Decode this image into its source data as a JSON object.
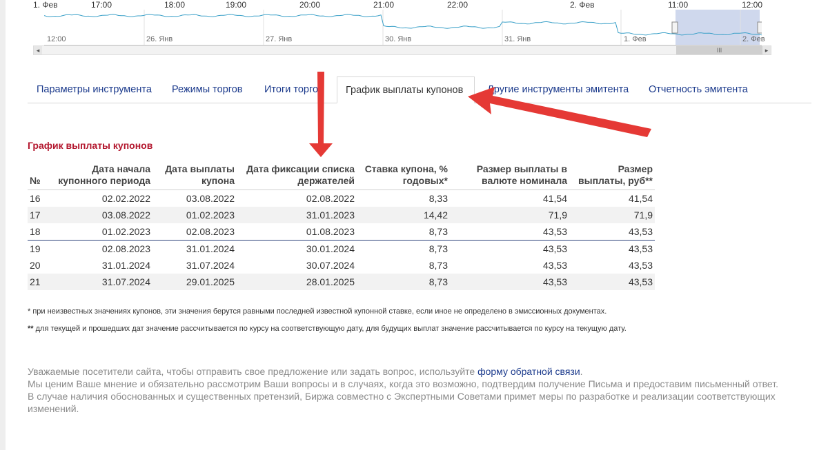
{
  "navigator": {
    "top_ticks": [
      "1. Фев",
      "17:00",
      "18:00",
      "19:00",
      "20:00",
      "21:00",
      "22:00",
      "2. Фев",
      "11:00",
      "12:00"
    ],
    "bottom_ticks": [
      "12:00",
      "26. Янв",
      "27. Янв",
      "30. Янв",
      "31. Янв",
      "1. Фев",
      "2. Фев"
    ],
    "scroll_left": "◂",
    "scroll_right": "▸",
    "thumb_grip": "III",
    "handle_grip": "II",
    "line_color": "#3aa0c8",
    "selection_color": "#c7d1ea"
  },
  "tabs": [
    {
      "label": "Параметры инструмента",
      "active": false
    },
    {
      "label": "Режимы торгов",
      "active": false
    },
    {
      "label": "Итоги торгов",
      "active": false
    },
    {
      "label": "График выплаты купонов",
      "active": true
    },
    {
      "label": "Другие инструменты эмитента",
      "active": false
    },
    {
      "label": "Отчетность эмитента",
      "active": false
    }
  ],
  "section_title": "График выплаты купонов",
  "table": {
    "headers": [
      "№",
      "Дата начала купонного периода",
      "Дата выплаты купона",
      "Дата фиксации списка держателей",
      "Ставка купона, % годовых*",
      "Размер выплаты в валюте номинала",
      "Размер выплаты, руб**"
    ],
    "rows": [
      [
        "16",
        "02.02.2022",
        "03.08.2022",
        "02.08.2022",
        "8,33",
        "41,54",
        "41,54"
      ],
      [
        "17",
        "03.08.2022",
        "01.02.2023",
        "31.01.2023",
        "14,42",
        "71,9",
        "71,9"
      ],
      [
        "18",
        "01.02.2023",
        "02.08.2023",
        "01.08.2023",
        "8,73",
        "43,53",
        "43,53"
      ],
      [
        "19",
        "02.08.2023",
        "31.01.2024",
        "30.01.2024",
        "8,73",
        "43,53",
        "43,53"
      ],
      [
        "20",
        "31.01.2024",
        "31.07.2024",
        "30.07.2024",
        "8,73",
        "43,53",
        "43,53"
      ],
      [
        "21",
        "31.07.2024",
        "29.01.2025",
        "28.01.2025",
        "8,73",
        "43,53",
        "43,53"
      ]
    ]
  },
  "notes": {
    "note1": "* при неизвестных значениях купонов, эти значения берутся равными последней известной купонной ставке, если иное не определено в эмиссионных документах.",
    "note2_mark": "**",
    "note2": " для текущей и прошедших дат значение рассчитывается по курсу на соответствующую дату, для будущих выплат значение рассчитывается по курсу на текущую дату."
  },
  "footer": {
    "p1_text": "Уважаемые посетители сайта, чтобы отправить свое предложение или задать вопрос, используйте ",
    "p1_link": "форму обратной связи",
    "p1_end": ".",
    "p2": "Мы ценим Ваше мнение и обязательно рассмотрим Ваши вопросы и в случаях, когда это возможно, подтвердим получение Письма и предоставим письменный ответ.",
    "p3": "В случае наличия обоснованных и существенных претензий, Биржа совместно с Экспертными Советами примет меры по разработке и реализации соответствующих изменений."
  },
  "annotation": {
    "arrow_color": "#e53935"
  }
}
